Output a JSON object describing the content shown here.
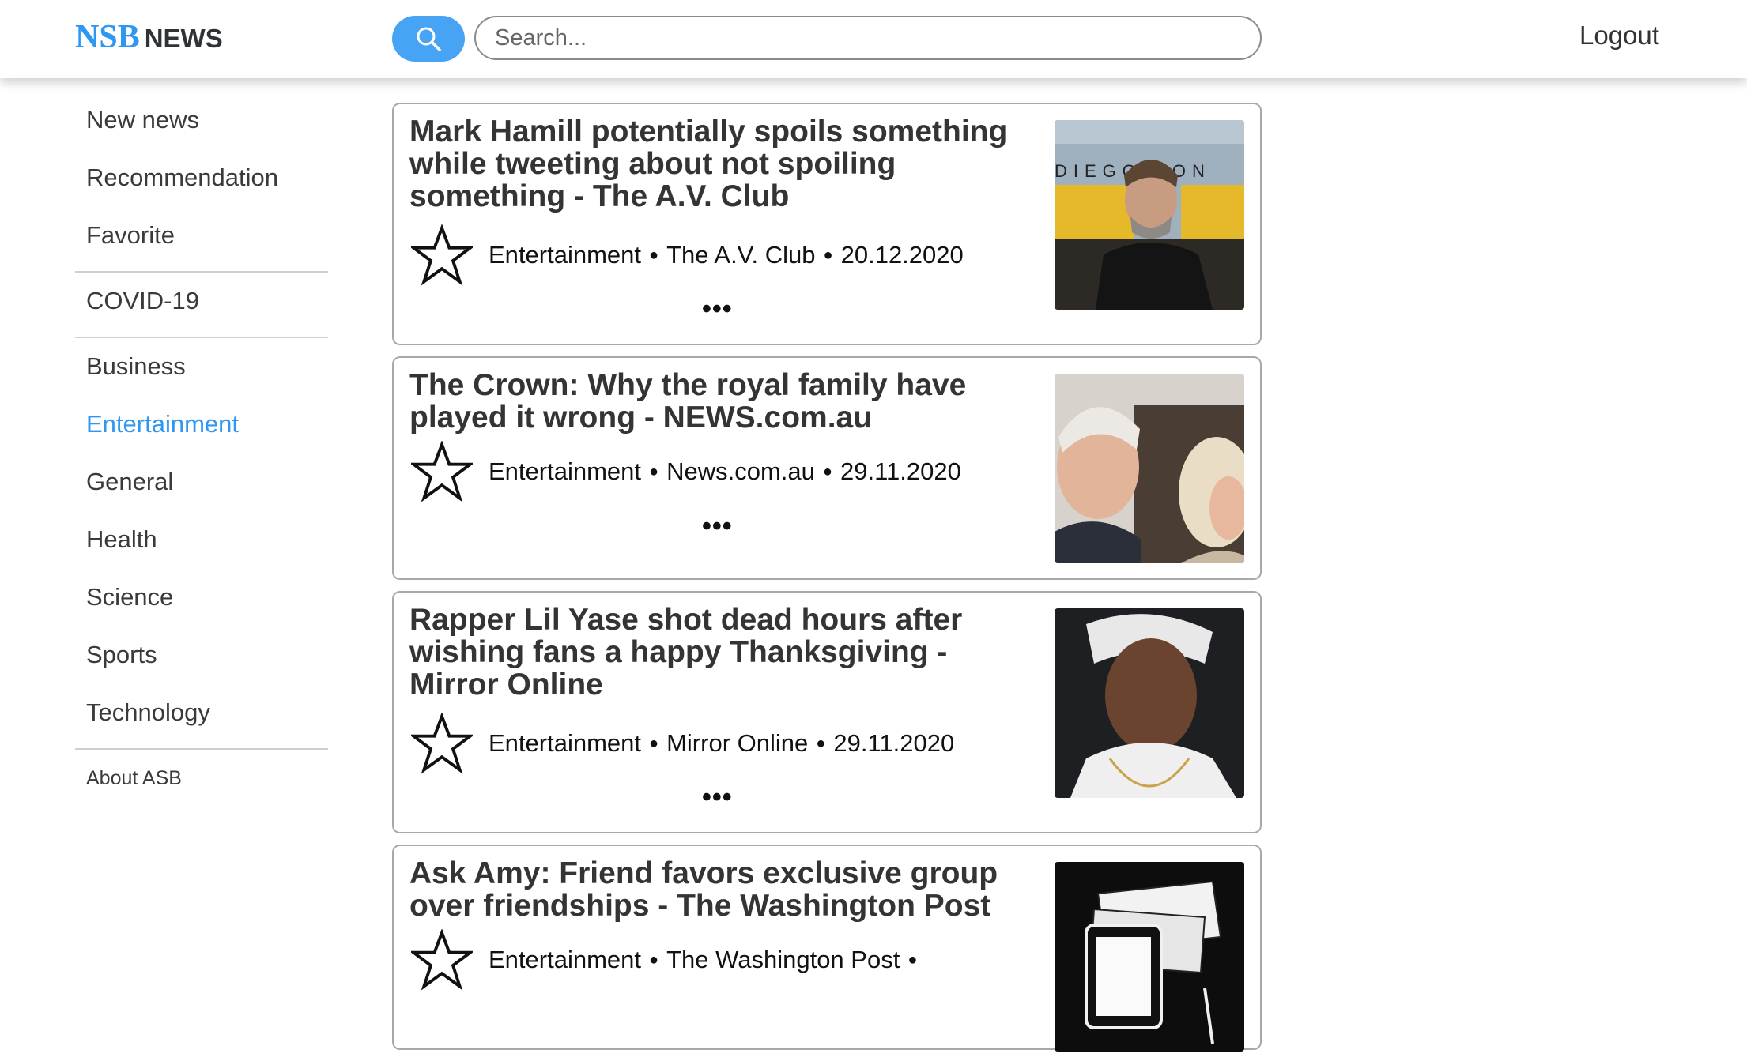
{
  "header": {
    "brand_nsb": "NSB",
    "brand_news": "NEWS",
    "search_placeholder": "Search...",
    "logout": "Logout"
  },
  "sidebar": {
    "items": [
      {
        "label": "New news"
      },
      {
        "label": "Recommendation"
      },
      {
        "label": "Favorite"
      },
      {
        "label": "COVID-19"
      },
      {
        "label": "Business"
      },
      {
        "label": "Entertainment",
        "active": true
      },
      {
        "label": "General"
      },
      {
        "label": "Health"
      },
      {
        "label": "Science"
      },
      {
        "label": "Sports"
      },
      {
        "label": "Technology"
      },
      {
        "label": "About ASB"
      }
    ]
  },
  "articles": [
    {
      "title": "Mark Hamill potentially spoils something while tweeting about not spoiling something - The A.V. Club",
      "category": "Entertainment",
      "source": "The A.V. Club",
      "date": "20.12.2020",
      "more": "•••"
    },
    {
      "title": "The Crown: Why the royal family have played it wrong - NEWS.com.au",
      "category": "Entertainment",
      "source": "News.com.au",
      "date": "29.11.2020",
      "more": "•••"
    },
    {
      "title": "Rapper Lil Yase shot dead hours after wishing fans a happy Thanksgiving - Mirror Online",
      "category": "Entertainment",
      "source": "Mirror Online",
      "date": "29.11.2020",
      "more": "•••"
    },
    {
      "title": "Ask Amy: Friend favors exclusive group over friendships - The Washington Post",
      "category": "Entertainment",
      "source": "The Washington Post",
      "date": "",
      "more": ""
    }
  ],
  "meta_separator": "●",
  "colors": {
    "accent": "#2d97f2",
    "search_button": "#47a4f5"
  },
  "icons": {
    "search": "search-icon",
    "favorite": "star-outline-icon"
  },
  "image_text": {
    "thumb1_sign": "DIEGO CON"
  }
}
